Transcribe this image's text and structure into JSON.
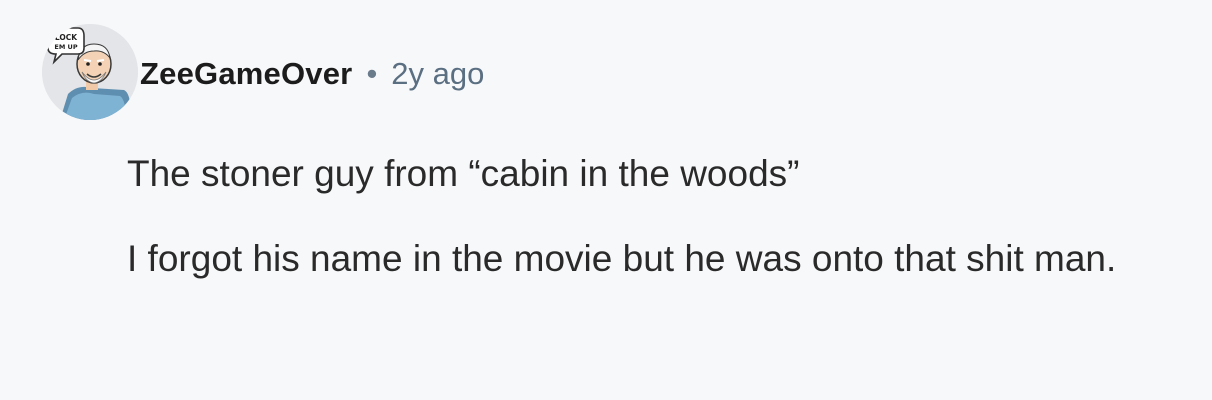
{
  "comment": {
    "author": "ZeeGameOver",
    "separator": "•",
    "timestamp": "2y ago",
    "avatar": {
      "icon": "old-man-avatar-icon",
      "badge_text": "LOCK EM UP"
    },
    "paragraphs": [
      "The stoner guy from “cabin in the woods”",
      "I forgot his name in the movie but he was onto that shit man."
    ]
  },
  "colors": {
    "background": "#f7f8fa",
    "username": "#1c1c1c",
    "meta": "#5b6f82",
    "body_text": "#2a2a2a"
  }
}
